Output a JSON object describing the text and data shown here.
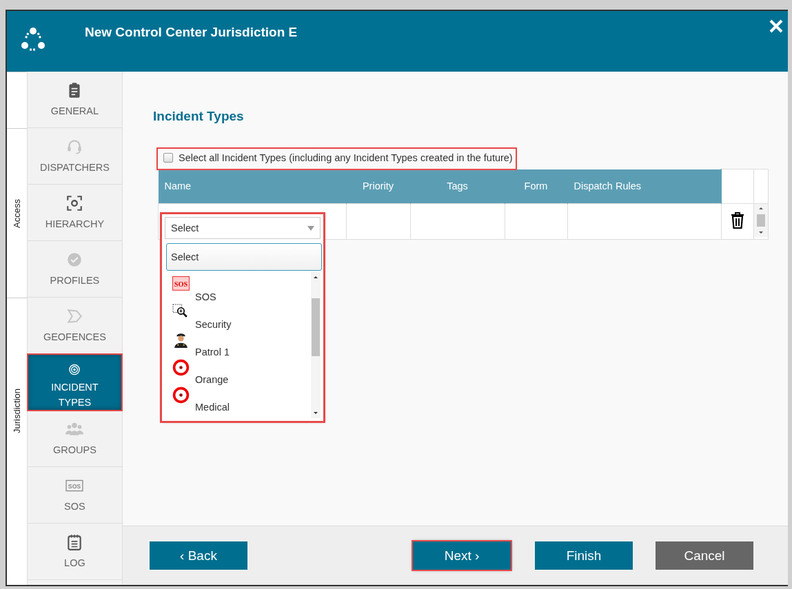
{
  "window": {
    "title": "New Control Center Jurisdiction E"
  },
  "sidebar": {
    "sections": [
      {
        "label": "Access"
      },
      {
        "label": "Jurisdiction"
      }
    ],
    "items": [
      {
        "label": "GENERAL",
        "enabled": true,
        "selected": false,
        "highlighted": false
      },
      {
        "label": "DISPATCHERS",
        "enabled": false,
        "selected": false,
        "highlighted": false
      },
      {
        "label": "HIERARCHY",
        "enabled": true,
        "selected": false,
        "highlighted": false
      },
      {
        "label": "PROFILES",
        "enabled": false,
        "selected": false,
        "highlighted": false
      },
      {
        "label": "GEOFENCES",
        "enabled": false,
        "selected": false,
        "highlighted": false
      },
      {
        "label": "INCIDENT TYPES",
        "enabled": true,
        "selected": true,
        "highlighted": true
      },
      {
        "label": "GROUPS",
        "enabled": false,
        "selected": false,
        "highlighted": false
      },
      {
        "label": "SOS",
        "icon_text": "SOS",
        "enabled": false,
        "selected": false,
        "highlighted": false
      },
      {
        "label": "LOG",
        "enabled": true,
        "selected": false,
        "highlighted": false
      }
    ]
  },
  "content": {
    "heading": "Incident Types",
    "select_all": {
      "label": "Select all Incident Types (including any Incident Types created in the future)",
      "checked": false,
      "highlighted": true
    },
    "table": {
      "columns": [
        "Name",
        "Priority",
        "Tags",
        "Form",
        "Dispatch Rules"
      ],
      "rows": [
        {
          "name_dropdown": {
            "value": "Select",
            "expanded": true,
            "highlighted": true,
            "search_placeholder": "Select",
            "options": [
              {
                "label": "SOS",
                "icon_text": "SOS"
              },
              {
                "label": "Security"
              },
              {
                "label": "Patrol 1"
              },
              {
                "label": "Orange"
              },
              {
                "label": "Medical"
              }
            ]
          }
        }
      ]
    }
  },
  "footer": {
    "buttons": [
      {
        "label": "‹ Back",
        "kind": "primary",
        "highlighted": false
      },
      {
        "label": "Next ›",
        "kind": "primary",
        "highlighted": true
      },
      {
        "label": "Finish",
        "kind": "primary",
        "highlighted": false
      },
      {
        "label": "Cancel",
        "kind": "secondary",
        "highlighted": false
      }
    ]
  }
}
